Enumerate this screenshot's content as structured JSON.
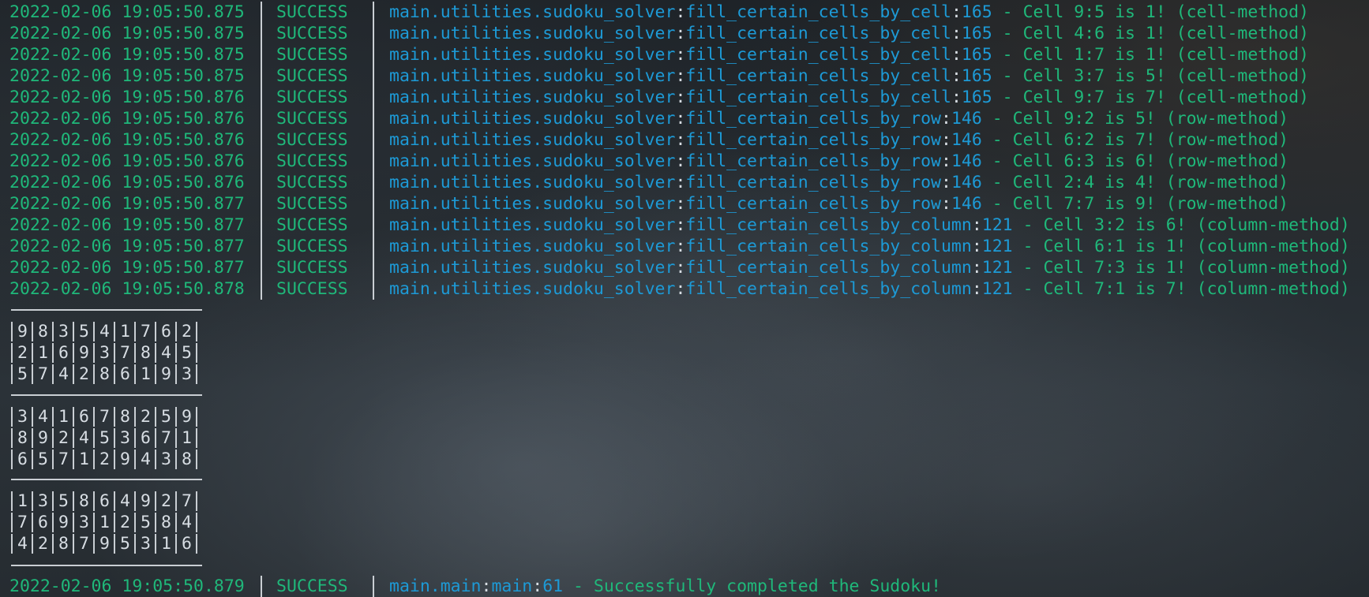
{
  "terminal": {
    "log_lines": [
      {
        "timestamp": "2022-02-06 19:05:50.875",
        "level": "SUCCESS",
        "module": "main.utilities.sudoku_solver",
        "function": "fill_certain_cells_by_cell",
        "line": "165",
        "message": " - Cell 9:5 is 1! (cell-method)"
      },
      {
        "timestamp": "2022-02-06 19:05:50.875",
        "level": "SUCCESS",
        "module": "main.utilities.sudoku_solver",
        "function": "fill_certain_cells_by_cell",
        "line": "165",
        "message": " - Cell 4:6 is 1! (cell-method)"
      },
      {
        "timestamp": "2022-02-06 19:05:50.875",
        "level": "SUCCESS",
        "module": "main.utilities.sudoku_solver",
        "function": "fill_certain_cells_by_cell",
        "line": "165",
        "message": " - Cell 1:7 is 1! (cell-method)"
      },
      {
        "timestamp": "2022-02-06 19:05:50.875",
        "level": "SUCCESS",
        "module": "main.utilities.sudoku_solver",
        "function": "fill_certain_cells_by_cell",
        "line": "165",
        "message": " - Cell 3:7 is 5! (cell-method)"
      },
      {
        "timestamp": "2022-02-06 19:05:50.876",
        "level": "SUCCESS",
        "module": "main.utilities.sudoku_solver",
        "function": "fill_certain_cells_by_cell",
        "line": "165",
        "message": " - Cell 9:7 is 7! (cell-method)"
      },
      {
        "timestamp": "2022-02-06 19:05:50.876",
        "level": "SUCCESS",
        "module": "main.utilities.sudoku_solver",
        "function": "fill_certain_cells_by_row",
        "line": "146",
        "message": " - Cell 9:2 is 5! (row-method)"
      },
      {
        "timestamp": "2022-02-06 19:05:50.876",
        "level": "SUCCESS",
        "module": "main.utilities.sudoku_solver",
        "function": "fill_certain_cells_by_row",
        "line": "146",
        "message": " - Cell 6:2 is 7! (row-method)"
      },
      {
        "timestamp": "2022-02-06 19:05:50.876",
        "level": "SUCCESS",
        "module": "main.utilities.sudoku_solver",
        "function": "fill_certain_cells_by_row",
        "line": "146",
        "message": " - Cell 6:3 is 6! (row-method)"
      },
      {
        "timestamp": "2022-02-06 19:05:50.876",
        "level": "SUCCESS",
        "module": "main.utilities.sudoku_solver",
        "function": "fill_certain_cells_by_row",
        "line": "146",
        "message": " - Cell 2:4 is 4! (row-method)"
      },
      {
        "timestamp": "2022-02-06 19:05:50.877",
        "level": "SUCCESS",
        "module": "main.utilities.sudoku_solver",
        "function": "fill_certain_cells_by_row",
        "line": "146",
        "message": " - Cell 7:7 is 9! (row-method)"
      },
      {
        "timestamp": "2022-02-06 19:05:50.877",
        "level": "SUCCESS",
        "module": "main.utilities.sudoku_solver",
        "function": "fill_certain_cells_by_column",
        "line": "121",
        "message": " - Cell 3:2 is 6! (column-method)"
      },
      {
        "timestamp": "2022-02-06 19:05:50.877",
        "level": "SUCCESS",
        "module": "main.utilities.sudoku_solver",
        "function": "fill_certain_cells_by_column",
        "line": "121",
        "message": " - Cell 6:1 is 1! (column-method)"
      },
      {
        "timestamp": "2022-02-06 19:05:50.877",
        "level": "SUCCESS",
        "module": "main.utilities.sudoku_solver",
        "function": "fill_certain_cells_by_column",
        "line": "121",
        "message": " - Cell 7:3 is 1! (column-method)"
      },
      {
        "timestamp": "2022-02-06 19:05:50.878",
        "level": "SUCCESS",
        "module": "main.utilities.sudoku_solver",
        "function": "fill_certain_cells_by_column",
        "line": "121",
        "message": " - Cell 7:1 is 7! (column-method)"
      }
    ],
    "sudoku_grid": [
      [
        "9",
        "8",
        "3",
        "5",
        "4",
        "1",
        "7",
        "6",
        "2"
      ],
      [
        "2",
        "1",
        "6",
        "9",
        "3",
        "7",
        "8",
        "4",
        "5"
      ],
      [
        "5",
        "7",
        "4",
        "2",
        "8",
        "6",
        "1",
        "9",
        "3"
      ],
      [
        "3",
        "4",
        "1",
        "6",
        "7",
        "8",
        "2",
        "5",
        "9"
      ],
      [
        "8",
        "9",
        "2",
        "4",
        "5",
        "3",
        "6",
        "7",
        "1"
      ],
      [
        "6",
        "5",
        "7",
        "1",
        "2",
        "9",
        "4",
        "3",
        "8"
      ],
      [
        "1",
        "3",
        "5",
        "8",
        "6",
        "4",
        "9",
        "2",
        "7"
      ],
      [
        "7",
        "6",
        "9",
        "3",
        "1",
        "2",
        "5",
        "8",
        "4"
      ],
      [
        "4",
        "2",
        "8",
        "7",
        "9",
        "5",
        "3",
        "1",
        "6"
      ]
    ],
    "final_line": {
      "timestamp": "2022-02-06 19:05:50.879",
      "level": "SUCCESS",
      "module": "main.main",
      "function": "main",
      "line": "61",
      "message": " - Successfully completed the Sudoku!"
    }
  },
  "colors": {
    "timestamp": "#1fb87a",
    "module": "#1d9ad6",
    "text": "#d7dde3"
  }
}
